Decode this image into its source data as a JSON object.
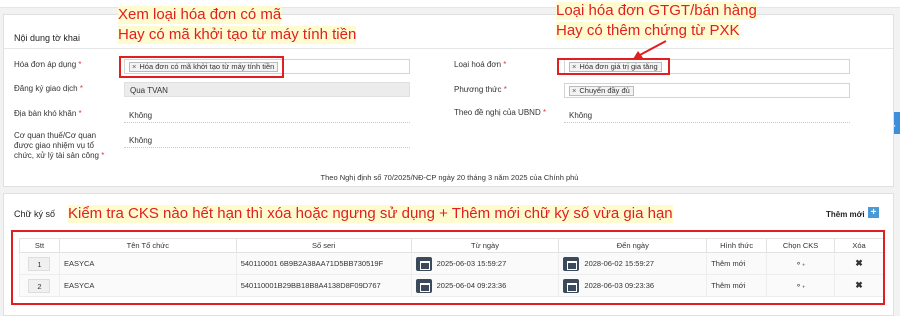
{
  "top_banner": "",
  "panel1": {
    "title": "Nội dung tờ khai",
    "fields_left": [
      {
        "label": "Hóa đơn áp dụng",
        "required": "*",
        "tag": "Hóa đơn có mã khởi tạo từ máy tính tiền"
      },
      {
        "label": "Đăng ký giao dịch",
        "required": "*",
        "value": "Qua TVAN"
      },
      {
        "label": "Địa bàn khó khăn",
        "required": "*",
        "value": "Không"
      },
      {
        "label": "Cơ quan thuế/Cơ quan được giao nhiệm vụ tổ chức, xử lý tài sản công",
        "required": "*",
        "value": "Không"
      }
    ],
    "fields_right": [
      {
        "label": "Loại hoá đơn",
        "required": "*",
        "tag": "Hóa đơn giá trị gia tăng"
      },
      {
        "label": "Phương thức",
        "required": "*",
        "tag": "Chuyển đầy đủ"
      },
      {
        "label": "Theo đề nghị của UBND",
        "required": "*",
        "value": "Không"
      }
    ],
    "note": "Theo Nghị định số 70/2025/NĐ-CP ngày 20 tháng 3 năm 2025 của Chính phủ"
  },
  "annotations": {
    "left_line1": "Xem loại hóa đơn có mã",
    "left_line2": "Hay có mã khởi tạo từ máy tính tiền",
    "right_line1": "Loại hóa đơn GTGT/bán hàng",
    "right_line2": "Hay có thêm chứng từ PXK",
    "bottom": "Kiểm tra CKS nào hết hạn thì xóa hoặc ngưng sử dụng + Thêm mới chữ ký số vừa gia hạn"
  },
  "panel2": {
    "title": "Chữ ký số",
    "add_label": "Thêm mới",
    "add_icon": "+",
    "columns": [
      "Stt",
      "Tên Tổ chức",
      "Số seri",
      "Từ ngày",
      "Đến ngày",
      "Hình thức",
      "Chọn CKS",
      "Xóa"
    ],
    "rows": [
      {
        "stt": "1",
        "org": "EASYCA",
        "serial": "540110001 6B9B2A38AA71D5BB730519F",
        "from": "2025-06-03 15:59:27",
        "to": "2028-06-02 15:59:27",
        "type": "Thêm mới",
        "select": "⚬₊",
        "delete": "✖"
      },
      {
        "stt": "2",
        "org": "EASYCA",
        "serial": "540110001B29BB18B8A4138D8F09D767",
        "from": "2025-06-04 09:23:36",
        "to": "2028-06-03 09:23:36",
        "type": "Thêm mới",
        "select": "⚬₊",
        "delete": "✖"
      }
    ]
  },
  "colors": {
    "accent_red": "#e02020",
    "highlight": "#fffbd0",
    "button_blue": "#4b9ad8"
  }
}
